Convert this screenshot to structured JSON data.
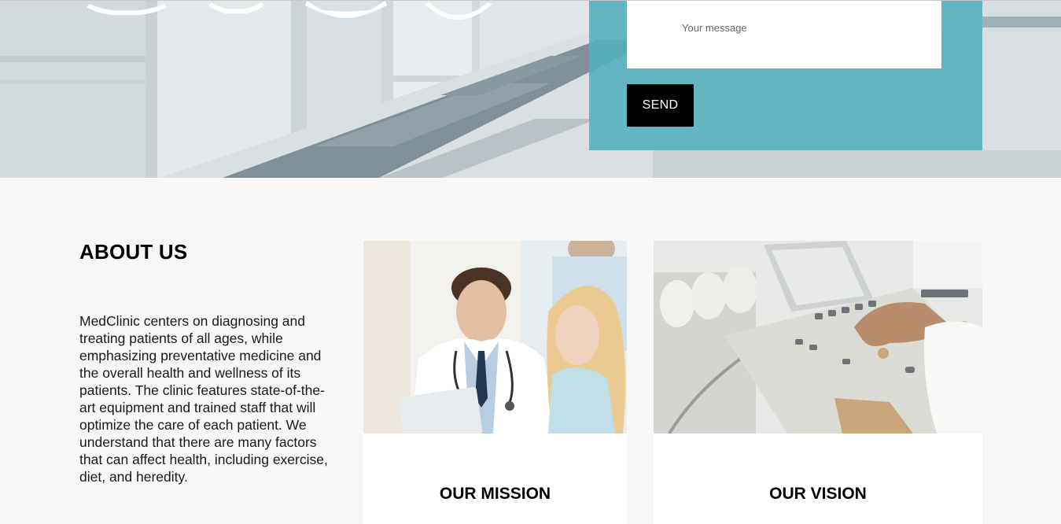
{
  "contact": {
    "message_placeholder": "Your message",
    "send_label": "SEND"
  },
  "about": {
    "title": "ABOUT US",
    "text": "MedClinic centers on diagnosing and treating patients of all ages, while emphasizing preventative medicine and the overall health and wellness of its patients. The clinic features state-of-the-art equipment and trained staff that will optimize the care of each patient. We understand that there are many factors that can affect health, including exercise, diet, and heredity."
  },
  "cards": {
    "mission_title": "OUR MISSION",
    "vision_title": "OUR VISION"
  },
  "colors": {
    "panel_accent": "#52afbe",
    "button_bg": "#000000",
    "section_bg": "#f7f7f7"
  },
  "icons": {
    "hero_emblems": [
      "laurel-wreath-icon",
      "laurel-wreath-icon",
      "ribbon-banner-icon",
      "circular-badge-icon"
    ]
  }
}
